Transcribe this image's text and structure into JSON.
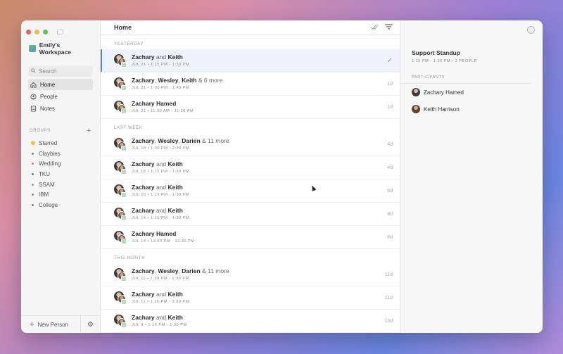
{
  "workspace": {
    "name": "Emily's Workspace"
  },
  "search": {
    "placeholder": "Search"
  },
  "nav": [
    {
      "label": "Home",
      "icon": "home-icon",
      "active": true
    },
    {
      "label": "People",
      "icon": "people-icon"
    },
    {
      "label": "Notes",
      "icon": "notes-icon"
    }
  ],
  "groups": {
    "header": "GROUPS",
    "items": [
      {
        "label": "Starred",
        "color": "#f4b860"
      },
      {
        "label": "Claybies",
        "color": "#d2557a"
      },
      {
        "label": "Wedding",
        "color": "#e07a4a"
      },
      {
        "label": "TKU",
        "color": "#3f7fd9"
      },
      {
        "label": "SSAM",
        "color": "#9a9a9a"
      },
      {
        "label": "IBM",
        "color": "#7a9a7a"
      },
      {
        "label": "College",
        "color": "#4a9a7a"
      }
    ]
  },
  "footer": {
    "new_person": "New Person"
  },
  "main": {
    "title": "Home",
    "sections": [
      {
        "label": "YESTERDAY",
        "rows": [
          {
            "p1": "Zachary",
            "mid": " and ",
            "p2": "Keith",
            "p3": "",
            "more": "",
            "sub": "JUL 21 • 1:15 PM - 1:30 PM",
            "right": "✓",
            "selected": true
          },
          {
            "p1": "Zachary",
            "mid": ", ",
            "p2": "Wesley",
            "p3": "Keith",
            "more": " & 6 more",
            "sub": "JUL 21 • 1:00 PM - 1:45 PM",
            "right": "1d"
          },
          {
            "p1": "Zachary Hamed",
            "mid": "",
            "p2": "",
            "p3": "",
            "more": "",
            "sub": "JUL 21 • 11:00 AM - 11:30 AM",
            "right": "1d"
          }
        ]
      },
      {
        "label": "LAST WEEK",
        "rows": [
          {
            "p1": "Zachary",
            "mid": ", ",
            "p2": "Wesley",
            "p3": "Darien",
            "more": " & 11 more",
            "sub": "JUL 18 • 1:30 PM - 2:30 PM",
            "right": "4d"
          },
          {
            "p1": "Zachary",
            "mid": " and ",
            "p2": "Keith",
            "p3": "",
            "more": "",
            "sub": "JUL 18 • 1:15 PM - 1:30 PM",
            "right": "4d"
          },
          {
            "p1": "Zachary",
            "mid": " and ",
            "p2": "Keith",
            "p3": "",
            "more": "",
            "sub": "JUL 16 • 1:15 PM - 1:30 PM",
            "right": "6d"
          },
          {
            "p1": "Zachary",
            "mid": " and ",
            "p2": "Keith",
            "p3": "",
            "more": "",
            "sub": "JUL 14 • 1:15 PM - 1:30 PM",
            "right": "8d"
          },
          {
            "p1": "Zachary Hamed",
            "mid": "",
            "p2": "",
            "p3": "",
            "more": "",
            "sub": "JUL 14 • 12:00 PM - 12:30 PM",
            "right": "8d"
          }
        ]
      },
      {
        "label": "THIS MONTH",
        "rows": [
          {
            "p1": "Zachary",
            "mid": ", ",
            "p2": "Wesley",
            "p3": "Darien",
            "more": " & 11 more",
            "sub": "JUL 11 • 1:30 PM - 2:30 PM",
            "right": "11d"
          },
          {
            "p1": "Zachary",
            "mid": " and ",
            "p2": "Keith",
            "p3": "",
            "more": "",
            "sub": "JUL 11 • 1:15 PM - 1:30 PM",
            "right": "11d"
          },
          {
            "p1": "Zachary",
            "mid": " and ",
            "p2": "Keith",
            "p3": "",
            "more": "",
            "sub": "JUL 9 • 1:15 PM - 1:30 PM",
            "right": "13d"
          }
        ]
      }
    ]
  },
  "detail": {
    "title": "Support Standup",
    "sub": "1:15 PM - 1:30 PM • 2 PEOPLE",
    "participants_label": "PARTICIPANTS",
    "participants": [
      "Zachary Hamed",
      "Keith Harrison"
    ]
  }
}
